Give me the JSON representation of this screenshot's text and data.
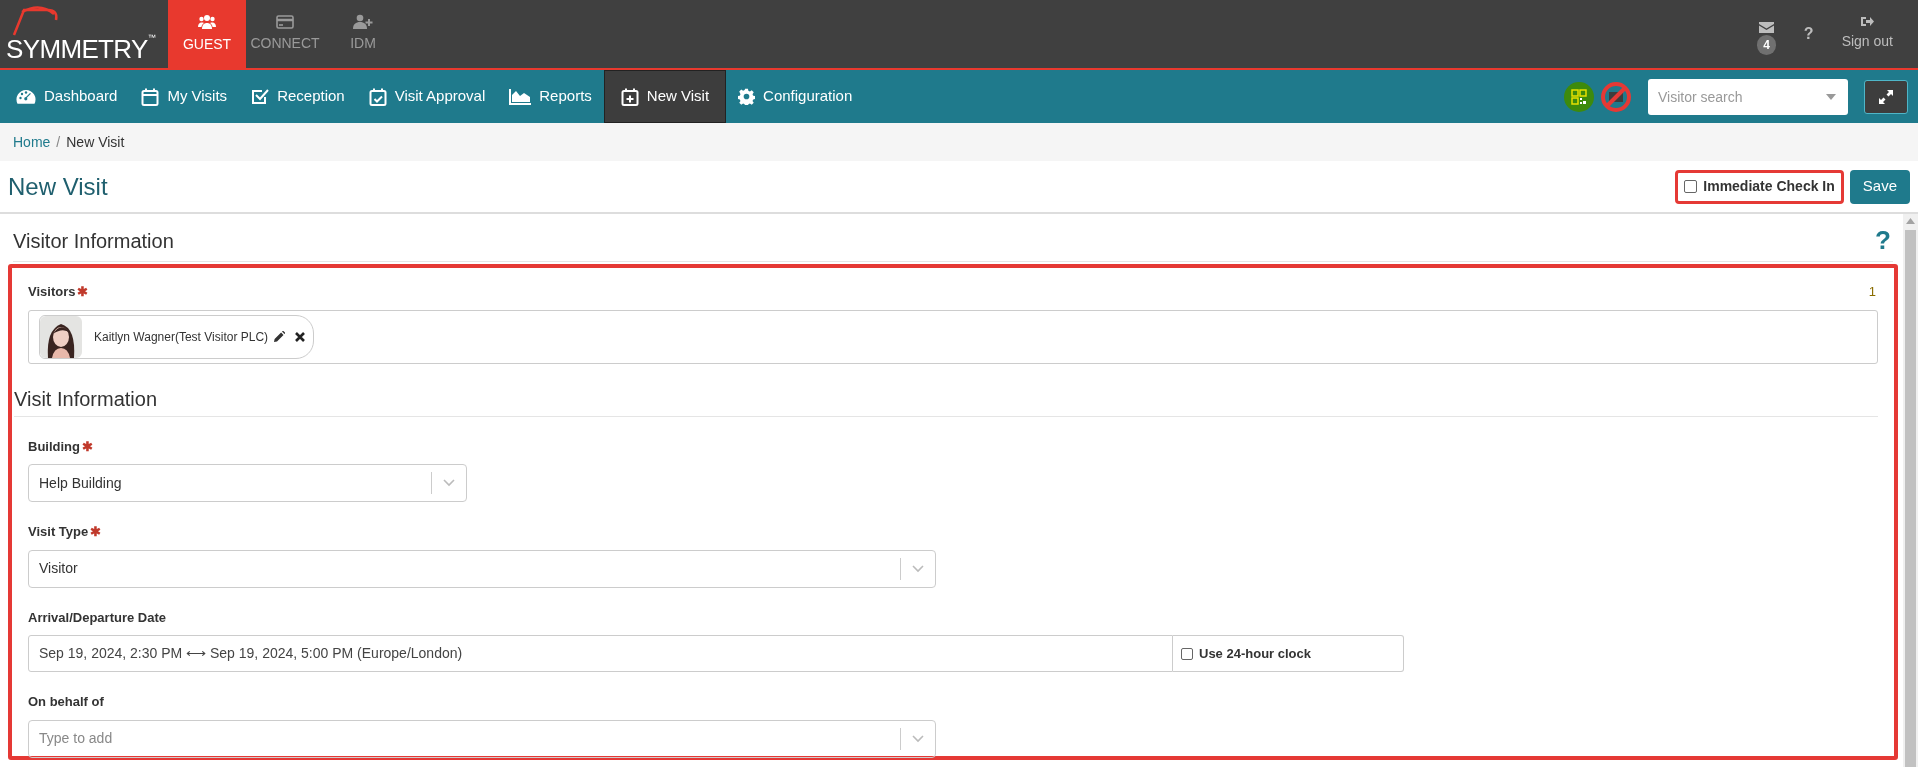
{
  "logo": {
    "text": "SYMMETRY",
    "mark": "™"
  },
  "apps": [
    {
      "label": "GUEST",
      "selected": true
    },
    {
      "label": "CONNECT",
      "selected": false
    },
    {
      "label": "IDM",
      "selected": false
    }
  ],
  "top_right": {
    "messages_count": "4",
    "help": "?",
    "sign_out": "Sign out"
  },
  "nav": [
    {
      "label": "Dashboard",
      "selected": false
    },
    {
      "label": "My Visits",
      "selected": false
    },
    {
      "label": "Reception",
      "selected": false
    },
    {
      "label": "Visit Approval",
      "selected": false
    },
    {
      "label": "Reports",
      "selected": false
    },
    {
      "label": "New Visit",
      "selected": true
    },
    {
      "label": "Configuration",
      "selected": false
    }
  ],
  "visitor_search": {
    "placeholder": "Visitor search"
  },
  "breadcrumb": {
    "items": [
      "Home",
      "New Visit"
    ],
    "separator": "/"
  },
  "required_mark": "✱",
  "page_title": "New Visit",
  "immediate_check_in": {
    "label": "Immediate Check In",
    "checked": false
  },
  "save_button": "Save",
  "visitor_information": {
    "heading": "Visitor Information",
    "help": "?",
    "visitors_label": "Visitors",
    "visitors_required": true,
    "visitors_count": "1",
    "visitors": [
      {
        "name": "Kaitlyn Wagner(Test Visitor PLC)"
      }
    ]
  },
  "visit_information": {
    "heading": "Visit Information",
    "fields": [
      {
        "kind": "select",
        "label": "Building",
        "required": true,
        "value": "Help Building"
      },
      {
        "kind": "select",
        "label": "Visit Type",
        "required": true,
        "value": "Visitor"
      },
      {
        "kind": "daterange",
        "label": "Arrival/Departure Date",
        "required": false,
        "value": "Sep 19, 2024, 2:30 PM ⟷ Sep 19, 2024, 5:00 PM (Europe/London)",
        "option": {
          "label": "Use 24-hour clock",
          "checked": false
        }
      },
      {
        "kind": "select",
        "label": "On behalf of",
        "required": false,
        "placeholder": "Type to add"
      }
    ]
  }
}
